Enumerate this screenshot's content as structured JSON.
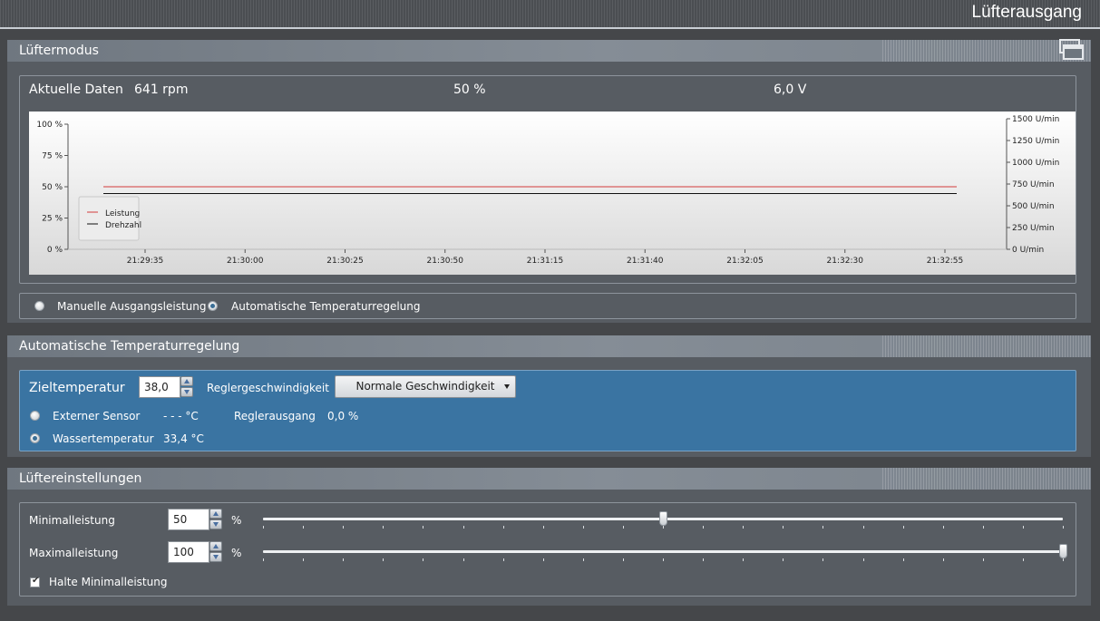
{
  "window": {
    "title": "Lüfterausgang"
  },
  "luftermodus": {
    "header": "Lüftermodus",
    "current": {
      "label": "Aktuelle Daten",
      "rpm": "641 rpm",
      "percent": "50 %",
      "voltage": "6,0 V"
    },
    "modes": [
      {
        "label": "Manuelle Ausgangsleistung",
        "selected": false
      },
      {
        "label": "Automatische Temperaturregelung",
        "selected": true
      }
    ]
  },
  "chart_data": {
    "type": "line",
    "x": [
      "21:29:35",
      "21:30:00",
      "21:30:25",
      "21:30:50",
      "21:31:15",
      "21:31:40",
      "21:32:05",
      "21:32:30",
      "21:32:55"
    ],
    "y_left_ticks": [
      "0 %",
      "25 %",
      "50 %",
      "75 %",
      "100 %"
    ],
    "y_right_ticks": [
      "0 U/min",
      "250 U/min",
      "500 U/min",
      "750 U/min",
      "1000 U/min",
      "1250 U/min",
      "1500 U/min"
    ],
    "ylim_left": [
      0,
      100
    ],
    "ylim_right": [
      0,
      1500
    ],
    "series": [
      {
        "name": "Leistung",
        "axis": "left",
        "color": "#d23a3a",
        "values": [
          50,
          50,
          50,
          50,
          50,
          50,
          50,
          50,
          50
        ]
      },
      {
        "name": "Drehzahl",
        "axis": "right",
        "color": "#111111",
        "values": [
          641,
          641,
          641,
          641,
          641,
          641,
          641,
          641,
          641
        ]
      }
    ],
    "legend": "bottom-left",
    "grid": false
  },
  "auto": {
    "header": "Automatische Temperaturregelung",
    "target_label": "Zieltemperatur",
    "target_value": "38,0",
    "speed_label": "Reglergeschwindigkeit",
    "speed_value": "Normale Geschwindigkeit",
    "ext_sensor_label": "Externer Sensor",
    "ext_sensor_value": "- - - °C",
    "output_label": "Reglerausgang",
    "output_value": "0,0 %",
    "water_label": "Wassertemperatur",
    "water_value": "33,4 °C"
  },
  "settings": {
    "header": "Lüftereinstellungen",
    "min_label": "Minimalleistung",
    "min_value": "50",
    "min_level": 50,
    "max_label": "Maximalleistung",
    "max_value": "100",
    "max_level": 100,
    "unit": "%",
    "hold_label": "Halte Minimalleistung",
    "hold_checked": true
  }
}
